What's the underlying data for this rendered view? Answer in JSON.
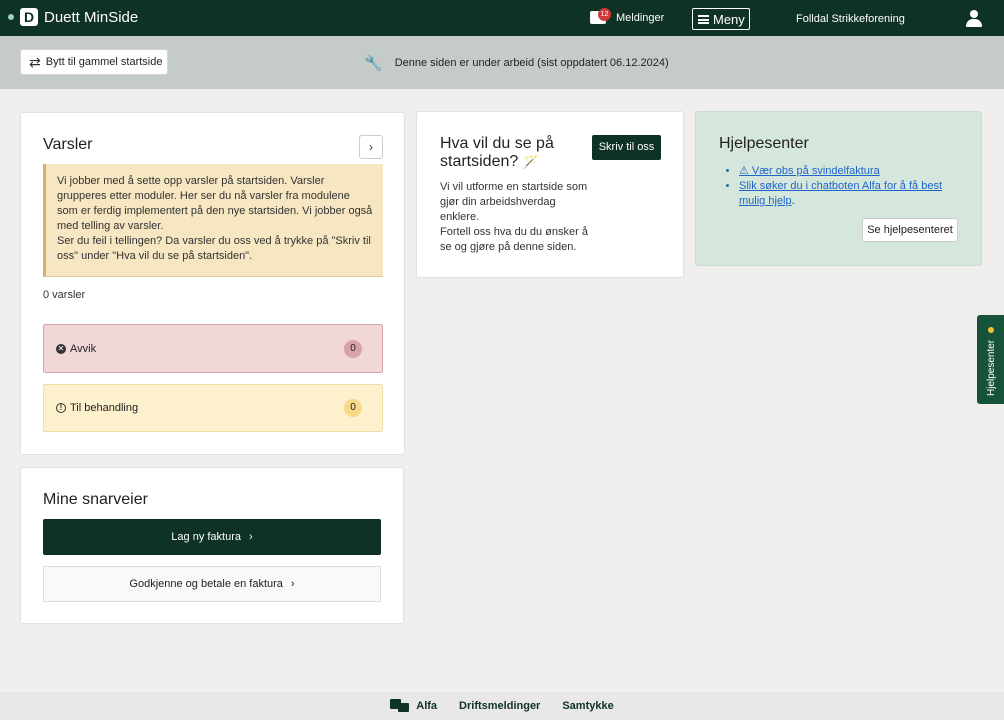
{
  "topbar": {
    "app_name": "Duett MinSide",
    "logo_letter": "D",
    "messages_label": "Meldinger",
    "messages_count": "12",
    "menu_label": "Meny",
    "org_name": "Folldal Strikkeforening"
  },
  "notice": {
    "switch_button": "Bytt til gammel startside",
    "status_text": "Denne siden er under arbeid (sist oppdatert 06.12.2024)"
  },
  "alerts": {
    "title": "Varsler",
    "info_paragraph_1": "Vi jobber med å sette opp varsler på startsiden. Varsler grupperes etter moduler. Her ser du nå varsler fra modulene som er ferdig implementert på den nye startsiden. Vi jobber også med telling av varsler.",
    "info_paragraph_2": "Ser du feil i tellingen? Da varsler du oss ved å trykke på \"Skriv til oss\" under \"Hva vil du se på startsiden\".",
    "count_text": "0 varsler",
    "rows": [
      {
        "label": "Avvik",
        "count": "0"
      },
      {
        "label": "Til behandling",
        "count": "0"
      }
    ]
  },
  "shortcuts": {
    "title": "Mine snarveier",
    "primary": "Lag ny faktura",
    "secondary": "Godkjenne og betale en faktura"
  },
  "wish": {
    "title": "Hva vil du se på startsiden?",
    "button": "Skriv til oss",
    "text_1": "Vi vil utforme en startside som gjør din arbeidshverdag enklere.",
    "text_2": "Fortell oss hva du du ønsker å se og gjøre på denne siden."
  },
  "help": {
    "title": "Hjelpesenter",
    "links": [
      "⚠ Vær obs på svindelfaktura",
      "Slik søker du i chatboten Alfa for å få best mulig hjelp"
    ],
    "link_suffix": ".",
    "button": "Se hjelpesenteret",
    "side_tab": "Hjelpesenter"
  },
  "footer": {
    "alfa": "Alfa",
    "drift": "Driftsmeldinger",
    "consent": "Samtykke"
  },
  "colors": {
    "brand_dark_green": "#0e3226",
    "notice_gray": "#c5ccc7",
    "help_green": "#d5e6dd",
    "warning_yellow": "#f6e6c2",
    "avvik_red": "#f1d7d7"
  }
}
